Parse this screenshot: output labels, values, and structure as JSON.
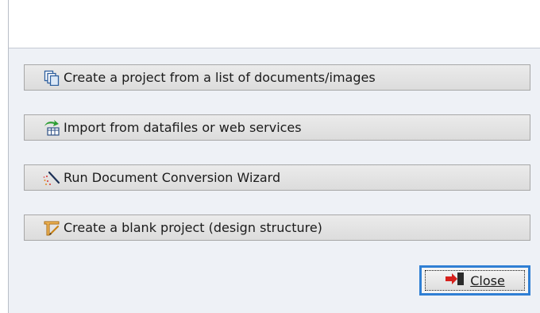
{
  "actions": [
    {
      "label": "Create a project from a list of documents/images",
      "icon": "copy-documents-icon"
    },
    {
      "label": "Import from datafiles or web services",
      "icon": "import-data-icon"
    },
    {
      "label": "Run Document Conversion Wizard",
      "icon": "magic-wand-icon"
    },
    {
      "label": "Create a blank project (design structure)",
      "icon": "blank-project-icon"
    }
  ],
  "close_button": {
    "label": "Close",
    "icon": "exit-icon"
  },
  "colors": {
    "dialog_bg": "#eef1f6",
    "button_face": "#e3e3e3",
    "focus_border": "#2f7fd4",
    "close_icon_red": "#d6201c"
  }
}
